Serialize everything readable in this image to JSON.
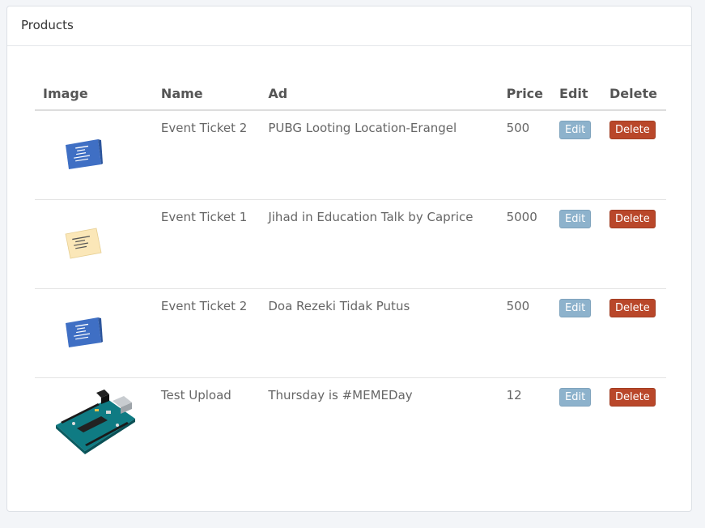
{
  "panel": {
    "title": "Products"
  },
  "table": {
    "headers": {
      "image": "Image",
      "name": "Name",
      "ad": "Ad",
      "price": "Price",
      "edit": "Edit",
      "delete": "Delete"
    },
    "rows": [
      {
        "image": "blue-ticket-image",
        "name": "Event Ticket 2",
        "ad": "PUBG Looting Location-Erangel",
        "price": "500",
        "edit": "Edit",
        "delete": "Delete"
      },
      {
        "image": "yellow-ticket-image",
        "name": "Event Ticket 1",
        "ad": "Jihad in Education Talk by Caprice",
        "price": "5000",
        "edit": "Edit",
        "delete": "Delete"
      },
      {
        "image": "blue-ticket-image",
        "name": "Event Ticket 2",
        "ad": "Doa Rezeki Tidak Putus",
        "price": "500",
        "edit": "Edit",
        "delete": "Delete"
      },
      {
        "image": "arduino-board-image",
        "name": "Test Upload",
        "ad": "Thursday is #MEMEDay",
        "price": "12",
        "edit": "Edit",
        "delete": "Delete"
      }
    ]
  },
  "colors": {
    "edit_button": "#8db2cc",
    "delete_button": "#b9472a",
    "blue_ticket": "#3f6fc4",
    "yellow_ticket": "#fbe7b8"
  }
}
